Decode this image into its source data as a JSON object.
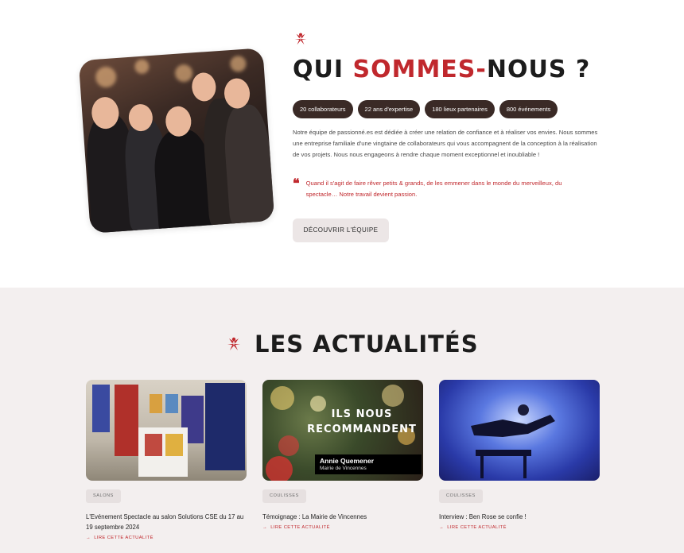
{
  "about": {
    "title_part1": "QUI ",
    "title_accent": "SOMMES-",
    "title_part2": "NOUS ?",
    "stats": [
      "20 collaborateurs",
      "22 ans d'expertise",
      "180 lieux partenaires",
      "800 événements"
    ],
    "paragraph": "Notre équipe de passionné.es est dédiée à créer une relation de confiance et à réaliser vos envies. Nous sommes une entreprise familiale d'une vingtaine de collaborateurs qui vous accompagnent de la conception à la réalisation de vos projets. Nous nous engageons à rendre chaque moment exceptionnel et inoubliable !",
    "quote_icon": "❝",
    "quote": "Quand il s'agit de faire rêver petits & grands, de les emmener dans le monde du merveilleux, du spectacle… Notre travail devient passion.",
    "button_label": "DÉCOUVRIR L'ÉQUIPE",
    "accent_color": "#c0282d",
    "pill_color": "#3a2a26"
  },
  "news": {
    "title": "LES ACTUALITÉS",
    "cards": [
      {
        "tag": "SALONS",
        "title": "L'Evénement Spectacle au salon Solutions CSE du 17 au 19 septembre 2024",
        "link": "LIRE CETTE ACTUALITÉ"
      },
      {
        "tag": "COULISSES",
        "title": "Témoignage : La Mairie de Vincennes",
        "link": "LIRE CETTE ACTUALITÉ",
        "overlay_line1": "ILS NOUS",
        "overlay_line2": "RECOMMANDENT",
        "overlay_name": "Annie Quemener",
        "overlay_role": "Mairie de Vincennes"
      },
      {
        "tag": "COULISSES",
        "title": "Interview : Ben Rose se confie !",
        "link": "LIRE CETTE ACTUALITÉ"
      }
    ],
    "link_arrow": "→",
    "background": "#f3efef"
  },
  "icons": {
    "brand_mark": "star-figure-icon"
  }
}
